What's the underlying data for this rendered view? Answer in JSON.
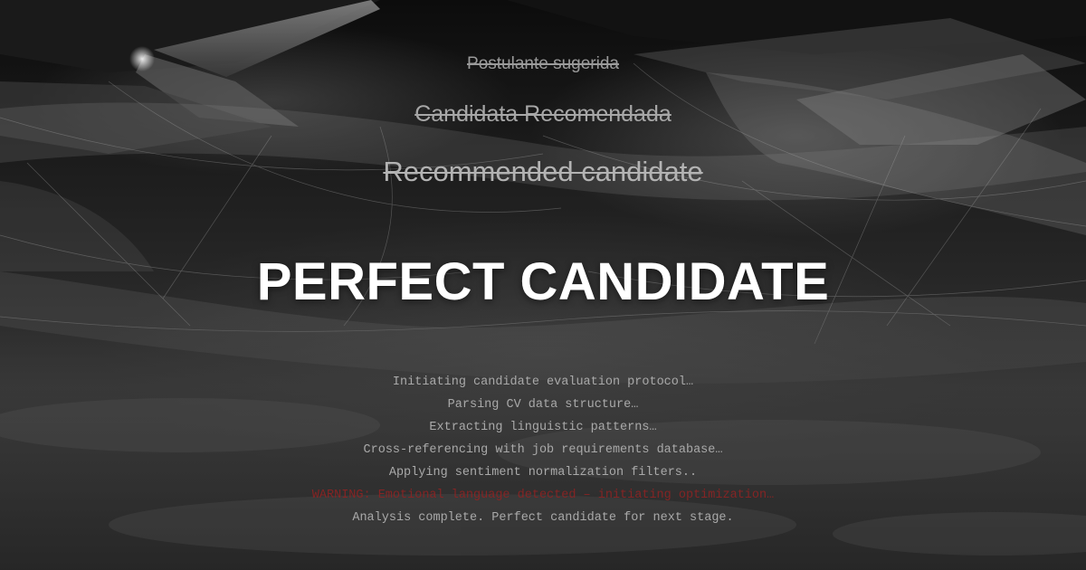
{
  "labels": {
    "es": "Postulante sugerida",
    "pt": "Candidata Recomendada",
    "en": "Recommended candidate"
  },
  "headline": "PERFECT CANDIDATE",
  "log_lines": [
    {
      "text": "Initiating candidate evaluation protocol…",
      "kind": "normal"
    },
    {
      "text": "Parsing CV data structure…",
      "kind": "normal"
    },
    {
      "text": "Extracting linguistic patterns…",
      "kind": "normal"
    },
    {
      "text": "Cross-referencing with job requirements database…",
      "kind": "normal"
    },
    {
      "text": "Applying sentiment normalization filters..",
      "kind": "normal"
    },
    {
      "text": "WARNING: Emotional language detected – initiating optimization…",
      "kind": "warning"
    },
    {
      "text": "Analysis complete. Perfect candidate for next stage.",
      "kind": "normal"
    }
  ],
  "colors": {
    "warning": "#8e2323",
    "log_text": "#a9a9a9",
    "headline": "#ffffff"
  }
}
